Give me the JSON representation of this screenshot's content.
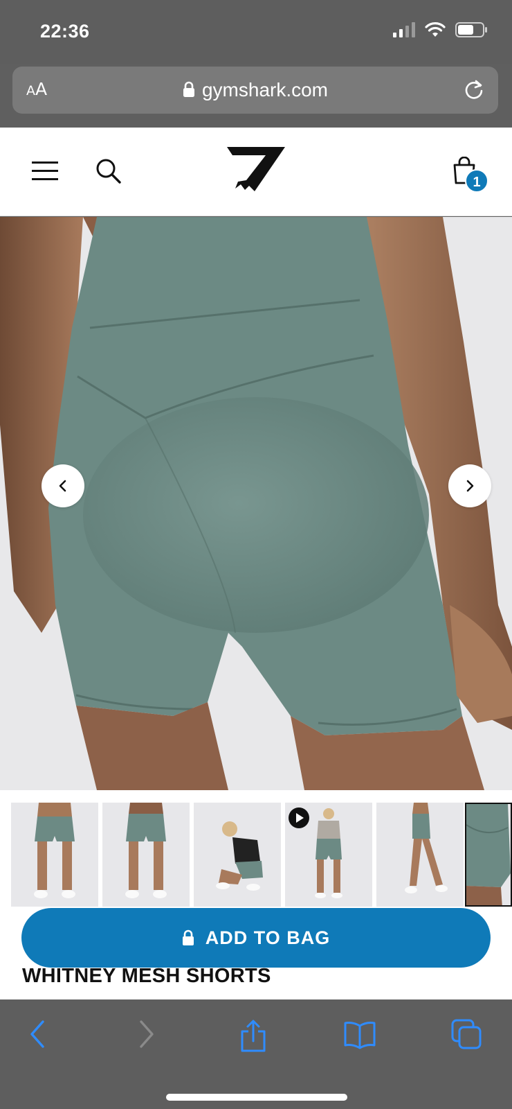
{
  "status_bar": {
    "time": "22:36"
  },
  "url_bar": {
    "text_size_small": "A",
    "text_size_big": "A",
    "domain": "gymshark.com"
  },
  "header": {
    "bag_count": "1"
  },
  "product": {
    "add_to_bag_label": "ADD TO BAG",
    "title": "WHITNEY MESH SHORTS",
    "colors": {
      "accent": "#0f7ab8",
      "shorts": "#6c8a84",
      "skin": "#a8775a"
    }
  },
  "icons": {
    "menu": "menu-icon",
    "search": "search-icon",
    "logo": "gymshark-logo",
    "bag": "shopping-bag-icon",
    "prev": "chevron-left-icon",
    "next": "chevron-right-icon",
    "back": "back-icon",
    "forward": "forward-icon",
    "share": "share-icon",
    "bookmarks": "bookmarks-icon",
    "tabs": "tabs-icon"
  }
}
